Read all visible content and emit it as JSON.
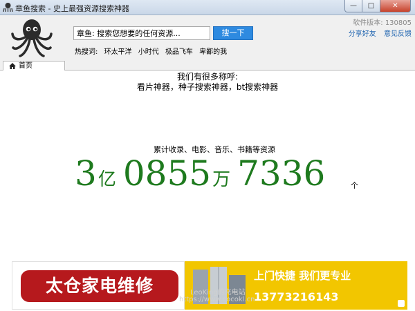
{
  "window": {
    "title": "章鱼搜索 - 史上最强资源搜索神器",
    "minimize": "—",
    "maximize": "□",
    "close": "✕"
  },
  "header": {
    "search_value": "章鱼: 搜索您想要的任何资源...",
    "search_button": "搜一下",
    "hot_label": "热搜词:",
    "hot_words": [
      "环太平洋",
      "小时代",
      "极品飞车",
      "卑鄙的我"
    ],
    "version": "软件版本: 130805",
    "share": "分享好友",
    "feedback": "意见反馈"
  },
  "tabs": {
    "home": "首页"
  },
  "main": {
    "intro_line1": "我们有很多称呼:",
    "intro_line2": "看片神器，种子搜索神器，bt搜索神器",
    "resources": "累计收录、电影、音乐、书籍等资源",
    "counter": {
      "yi_num": "3",
      "yi_unit": "亿",
      "wan_num": "0855",
      "wan_unit": "万",
      "rest_num": "7336",
      "ge_unit": "个"
    }
  },
  "banner": {
    "left_text": "太仓家电维修",
    "slogan": "上门快捷 我们更专业",
    "phone": "13773216143",
    "watermark1": "LeoKing的充电站",
    "watermark2": "https://www.cocokl.cn",
    "bg_color": "#f2c600"
  },
  "colors": {
    "counter_green": "#1e7a1e",
    "search_blue": "#2e8ae0",
    "link_blue": "#1f64b0"
  }
}
